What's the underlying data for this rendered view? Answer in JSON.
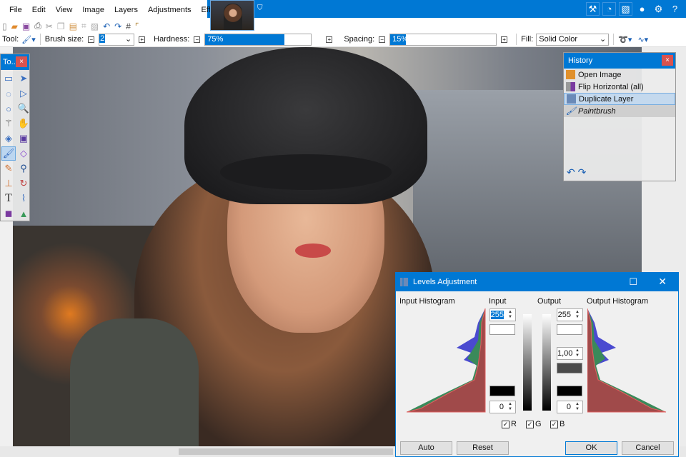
{
  "menu": [
    "File",
    "Edit",
    "View",
    "Image",
    "Layers",
    "Adjustments",
    "Effects"
  ],
  "toolbar_icons": [
    "new-icon",
    "open-icon",
    "save-icon",
    "print-icon",
    "cut-icon",
    "copy-icon",
    "paste-icon",
    "crop-icon",
    "deselect-icon",
    "undo-icon",
    "redo-icon",
    "grid-icon",
    "ruler-icon"
  ],
  "right_icons": [
    "tools-icon",
    "history-icon",
    "layers-icon",
    "colors-icon",
    "settings-icon",
    "help-icon"
  ],
  "options": {
    "tool_label": "Tool:",
    "brush_size_label": "Brush size:",
    "brush_size": "2",
    "hardness_label": "Hardness:",
    "hardness": "75%",
    "hardness_pct": 75,
    "spacing_label": "Spacing:",
    "spacing": "15%",
    "spacing_pct": 15,
    "fill_label": "Fill:",
    "fill": "Solid Color"
  },
  "tools": {
    "title": "To...",
    "close": "×"
  },
  "history": {
    "title": "History",
    "close": "×",
    "items": [
      "Open Image",
      "Flip Horizontal (all)",
      "Duplicate Layer",
      "Paintbrush"
    ],
    "selected": "Duplicate Layer"
  },
  "levels": {
    "title": "Levels Adjustment",
    "input_histogram": "Input Histogram",
    "input": "Input",
    "output": "Output",
    "output_histogram": "Output Histogram",
    "input_high": "255",
    "input_low": "0",
    "output_high": "255",
    "output_gamma": "1,00",
    "output_low": "0",
    "channels": [
      "R",
      "G",
      "B"
    ],
    "auto": "Auto",
    "reset": "Reset",
    "ok": "OK",
    "cancel": "Cancel"
  },
  "colors": {
    "accent": "#0078d4",
    "close": "#d9534f"
  }
}
